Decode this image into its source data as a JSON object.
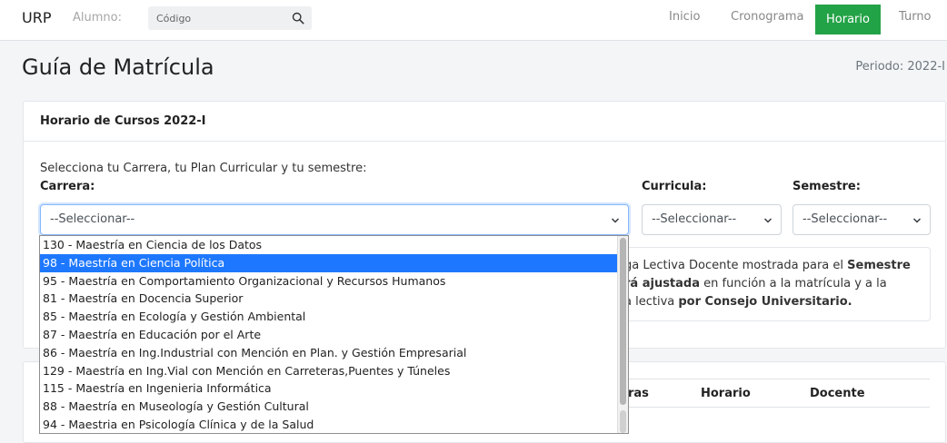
{
  "navbar": {
    "brand": "URP",
    "alumno_label": "Alumno:",
    "search_placeholder": "Código",
    "items": [
      {
        "label": "Inicio"
      },
      {
        "label": "Cronograma"
      },
      {
        "label": "Horario",
        "active": true
      },
      {
        "label": "Turno"
      }
    ],
    "active_color": "#23a347"
  },
  "header": {
    "title": "Guía de Matrícula",
    "periodo": "Periodo: 2022-I"
  },
  "card": {
    "title": "Horario de Cursos 2022-I",
    "instructions": "Selecciona tu Carrera, tu Plan Curricular y tu semestre:",
    "carrera_label": "Carrera:",
    "curricula_label": "Curricula:",
    "semestre_label": "Semestre:",
    "carrera_value": "--Seleccionar--",
    "curricula_value": "--Seleccionar--",
    "semestre_value": "--Seleccionar--",
    "alert": {
      "line1_pre": "ga Lectiva Docente mostrada para el ",
      "line1_bold": "Semestre",
      "line2_bold": "rá ajustada",
      "line2_post": " en función a la matrícula y a la",
      "line3_pre": "a lectiva ",
      "line3_bold": "por Consejo Universitario."
    }
  },
  "table": {
    "headers": [
      "ras",
      "Horario",
      "Docente"
    ]
  },
  "dropdown": {
    "options": [
      {
        "label": "130 - Maestría en Ciencia de los Datos",
        "selected": false
      },
      {
        "label": "98 - Maestría en Ciencia Política",
        "selected": true
      },
      {
        "label": "95 - Maestría en Comportamiento Organizacional y Recursos Humanos",
        "selected": false
      },
      {
        "label": "81 - Maestría en Docencia Superior",
        "selected": false
      },
      {
        "label": "85 - Maestría en Ecología y Gestión Ambiental",
        "selected": false
      },
      {
        "label": "87 - Maestría en Educación por el Arte",
        "selected": false
      },
      {
        "label": "86 - Maestría en Ing.Industrial con Mención en Plan. y Gestión Empresarial",
        "selected": false
      },
      {
        "label": "129 - Maestría en Ing.Vial con Mención en Carreteras,Puentes y Túneles",
        "selected": false
      },
      {
        "label": "115 - Maestría en Ingenieria Informática",
        "selected": false
      },
      {
        "label": "88 - Maestría en Museología y Gestión Cultural",
        "selected": false
      },
      {
        "label": "94 - Maestria en Psicología Clínica y de la Salud",
        "selected": false
      }
    ],
    "highlight_color": "#1e78ff"
  }
}
